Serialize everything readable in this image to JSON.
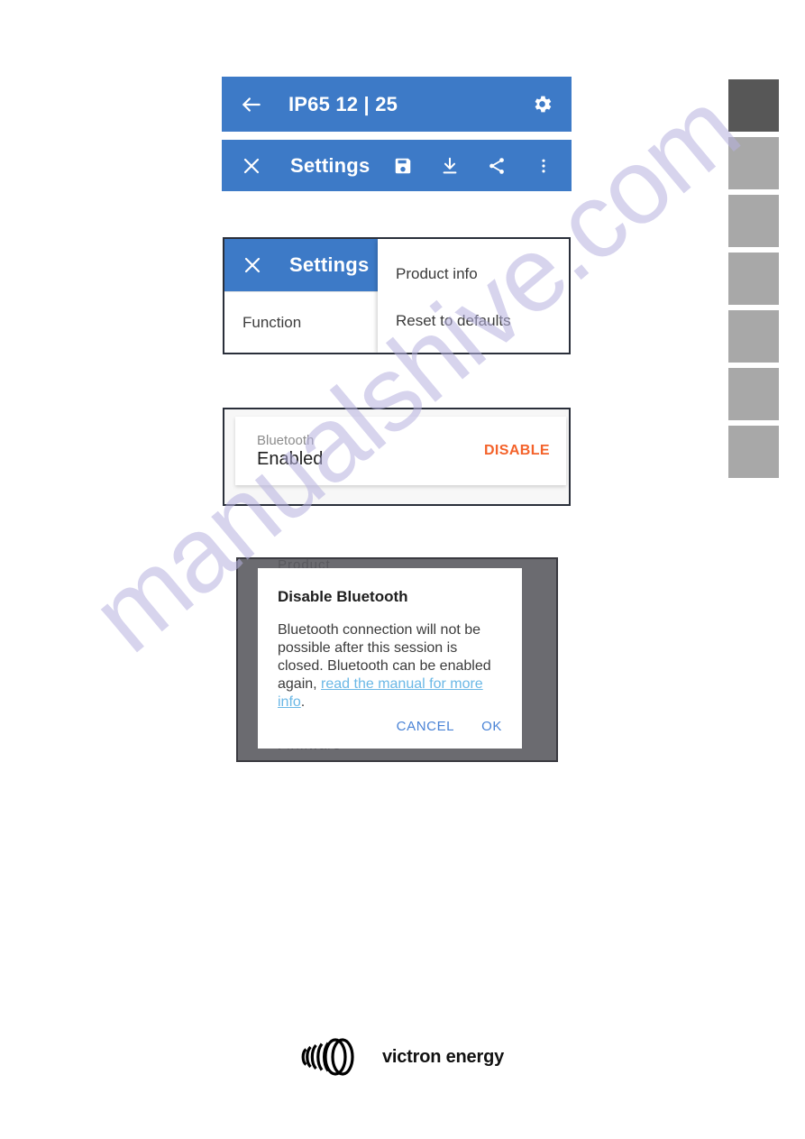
{
  "document": {
    "watermark": "manualshive.com",
    "footer": {
      "brand": "victron energy",
      "logo_icon": "victron-coil-logo"
    },
    "side_tabs": [
      {
        "index": 1,
        "active": true
      },
      {
        "index": 2,
        "active": false
      },
      {
        "index": 3,
        "active": false
      },
      {
        "index": 4,
        "active": false
      },
      {
        "index": 5,
        "active": false
      },
      {
        "index": 6,
        "active": false
      },
      {
        "index": 7,
        "active": false
      }
    ]
  },
  "colors": {
    "appbar_blue": "#3d7ac7",
    "disable_orange": "#f4622a",
    "link_blue": "#6bb8e6",
    "button_blue": "#4a83d6",
    "tab_active": "#575757",
    "tab_inactive": "#a8a8a8"
  },
  "figure_appbars": {
    "top_bar": {
      "back_icon": "arrow-left-icon",
      "title": "IP65 12 | 25",
      "settings_icon": "gear-icon"
    },
    "settings_bar": {
      "close_icon": "close-icon",
      "title": "Settings",
      "actions": [
        {
          "icon": "save-icon",
          "label": "Save"
        },
        {
          "icon": "download-icon",
          "label": "Download"
        },
        {
          "icon": "share-icon",
          "label": "Share"
        },
        {
          "icon": "overflow-menu-icon",
          "label": "More options"
        }
      ]
    }
  },
  "figure_menu": {
    "appbar": {
      "close_icon": "close-icon",
      "title": "Settings"
    },
    "row_label": "Function",
    "popup_items": [
      "Product info",
      "Reset to defaults"
    ]
  },
  "figure_bluetooth": {
    "label": "Bluetooth",
    "value": "Enabled",
    "action": "DISABLE"
  },
  "figure_dialog": {
    "background_text_top": "Product",
    "background_text_bottom": "Firmware",
    "title": "Disable Bluetooth",
    "body_before_link": "Bluetooth connection will not be possible after this session is closed. Bluetooth can be enabled again, ",
    "body_link": "read the manual for more info",
    "body_after_link": ".",
    "cancel_label": "CANCEL",
    "ok_label": "OK"
  }
}
